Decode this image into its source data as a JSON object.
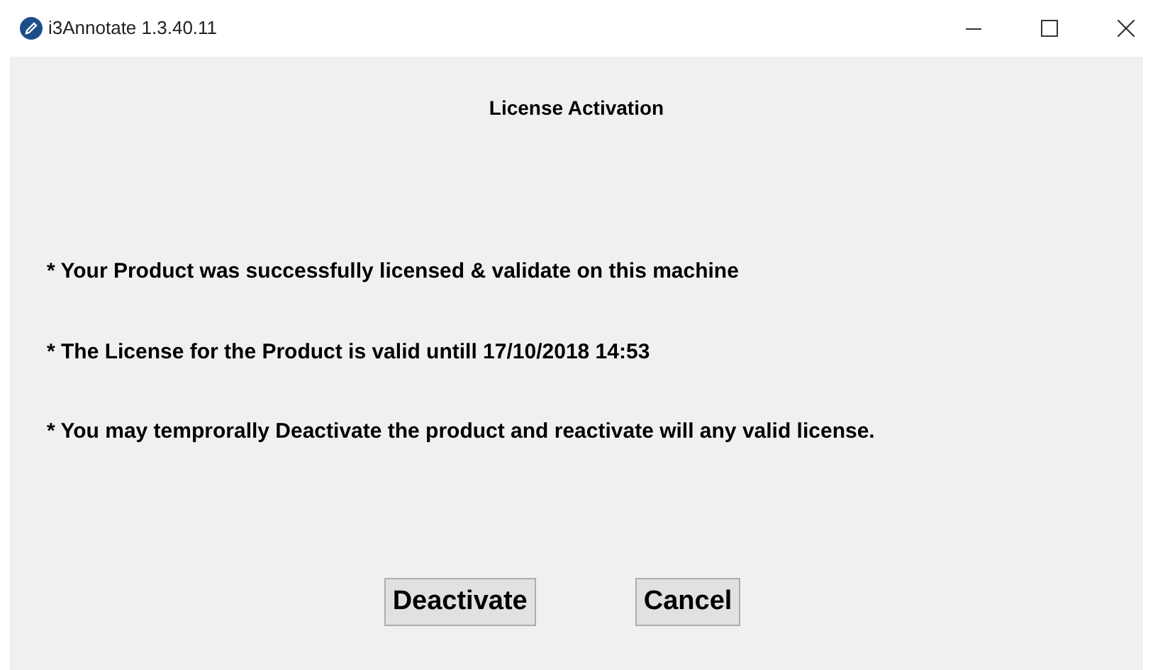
{
  "window": {
    "title": "i3Annotate 1.3.40.11"
  },
  "heading": "License Activation",
  "messages": [
    "* Your Product was successfully licensed & validate on this machine",
    "* The License for the Product is valid untill 17/10/2018 14:53",
    "* You may temprorally Deactivate the product and reactivate will any valid license."
  ],
  "buttons": [
    "Deactivate",
    "Cancel"
  ]
}
